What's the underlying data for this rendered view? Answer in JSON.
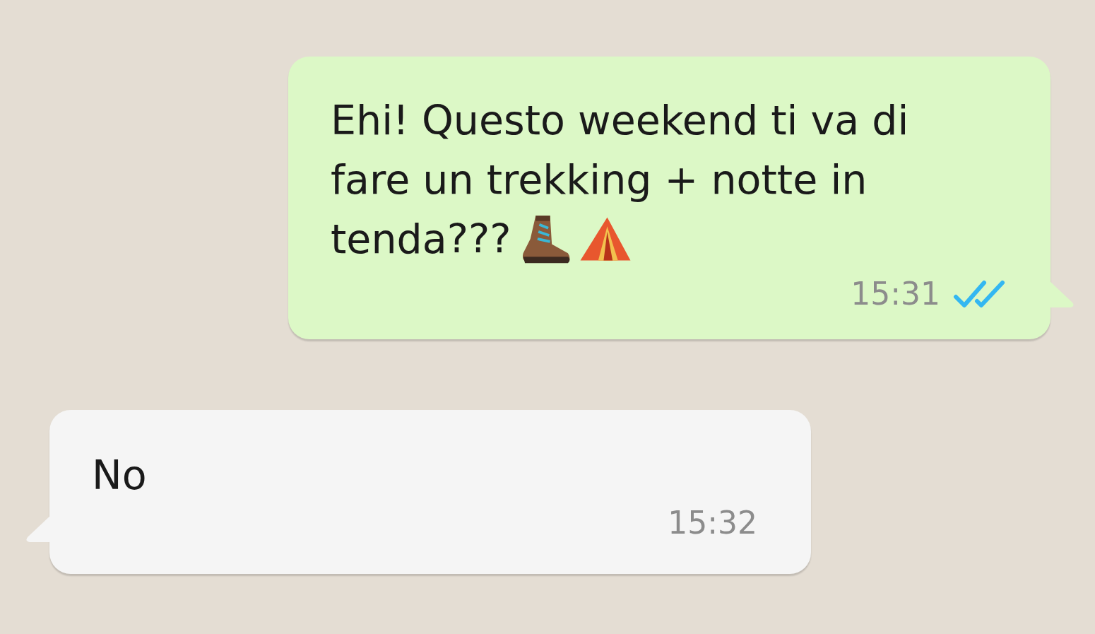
{
  "messages": [
    {
      "kind": "outgoing",
      "lines": [
        "Ehi! Questo weekend ti va di",
        "fare un trekking + notte in",
        "tenda???"
      ],
      "stickers": [
        {
          "kind": "boot"
        },
        {
          "kind": "tent"
        }
      ],
      "time": "15:31",
      "read": true
    },
    {
      "kind": "incoming",
      "lines": [
        "No"
      ],
      "time": "15:32"
    }
  ]
}
